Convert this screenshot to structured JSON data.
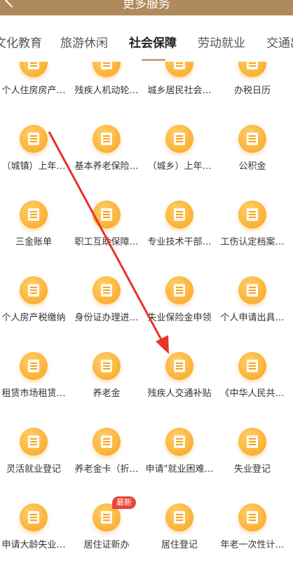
{
  "header": {
    "title": "更多服务"
  },
  "tabs": [
    {
      "label": "文化教育",
      "active": false
    },
    {
      "label": "旅游休闲",
      "active": false
    },
    {
      "label": "社会保障",
      "active": true
    },
    {
      "label": "劳动就业",
      "active": false
    },
    {
      "label": "交通出",
      "active": false
    }
  ],
  "services": [
    {
      "label": "个人住房房产…",
      "icon": "house-document-icon"
    },
    {
      "label": "残疾人机动轮…",
      "icon": "wheelchair-icon"
    },
    {
      "label": "城乡居民社会…",
      "icon": "document-icon"
    },
    {
      "label": "办税日历",
      "icon": "calendar-icon"
    },
    {
      "label": "（城镇）上年…",
      "icon": "hands-heart-icon"
    },
    {
      "label": "基本养老保险…",
      "icon": "document-icon"
    },
    {
      "label": "（城乡）上年…",
      "icon": "wheat-icon"
    },
    {
      "label": "公积金",
      "icon": "house-yen-icon"
    },
    {
      "label": "三金账单",
      "icon": "house-yen-icon"
    },
    {
      "label": "职工互助保障…",
      "icon": "id-card-icon"
    },
    {
      "label": "专业技术干部…",
      "icon": "certificate-icon"
    },
    {
      "label": "工伤认定档案…",
      "icon": "document-icon"
    },
    {
      "label": "个人房产税缴纳",
      "icon": "house-yen-icon"
    },
    {
      "label": "身份证办理进…",
      "icon": "id-card-icon"
    },
    {
      "label": "失业保险金申领",
      "icon": "money-bag-icon"
    },
    {
      "label": "个人申请出具…",
      "icon": "person-document-icon"
    },
    {
      "label": "租赁市场租赁…",
      "icon": "money-bag-icon"
    },
    {
      "label": "养老金",
      "icon": "elderly-person-icon"
    },
    {
      "label": "残疾人交通补贴",
      "icon": "bus-icon"
    },
    {
      "label": "《中华人民共…",
      "icon": "document-clock-icon"
    },
    {
      "label": "灵活就业登记",
      "icon": "tie-document-icon"
    },
    {
      "label": "养老金卡（折…",
      "icon": "card-icon"
    },
    {
      "label": "申请\"就业困难…",
      "icon": "briefcase-icon"
    },
    {
      "label": "失业登记",
      "icon": "briefcase-icon"
    },
    {
      "label": "申请大龄失业…",
      "icon": "people-clock-icon"
    },
    {
      "label": "居住证新办",
      "icon": "document-icon",
      "badge": "最新"
    },
    {
      "label": "居住登记",
      "icon": "house-icon"
    },
    {
      "label": "年老一次性计…",
      "icon": "elderly-person-icon"
    }
  ],
  "annotation_color": "#e8332a",
  "brand_color": "#b08a5c",
  "icon_color": "#f9a21f"
}
